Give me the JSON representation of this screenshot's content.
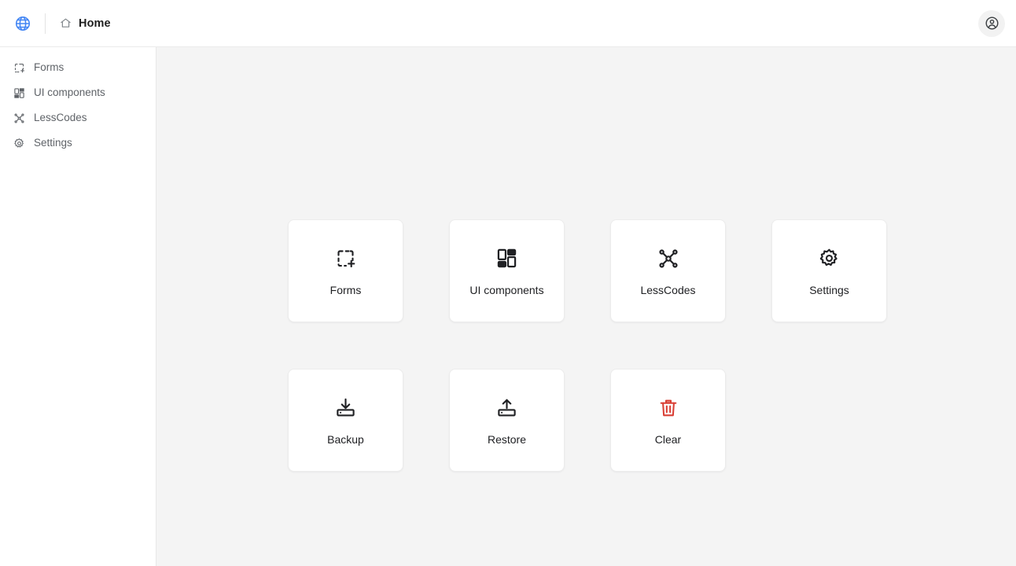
{
  "topbar": {
    "brand_icon": "globe-icon",
    "brand_color": "#4285f4",
    "breadcrumb_icon": "home-icon",
    "breadcrumb_label": "Home",
    "avatar_icon": "user-circle-icon"
  },
  "sidebar": {
    "items": [
      {
        "label": "Forms",
        "icon": "dashed-square-plus-icon"
      },
      {
        "label": "UI components",
        "icon": "layout-blocks-icon"
      },
      {
        "label": "LessCodes",
        "icon": "node-network-icon"
      },
      {
        "label": "Settings",
        "icon": "gear-icon"
      }
    ]
  },
  "main": {
    "tiles": [
      {
        "label": "Forms",
        "icon": "dashed-square-plus-icon",
        "color": "#202124"
      },
      {
        "label": "UI components",
        "icon": "layout-blocks-icon",
        "color": "#202124"
      },
      {
        "label": "LessCodes",
        "icon": "node-network-icon",
        "color": "#202124"
      },
      {
        "label": "Settings",
        "icon": "gear-icon",
        "color": "#202124"
      },
      {
        "label": "Backup",
        "icon": "download-tray-icon",
        "color": "#202124"
      },
      {
        "label": "Restore",
        "icon": "upload-tray-icon",
        "color": "#202124"
      },
      {
        "label": "Clear",
        "icon": "trash-icon",
        "color": "#d93f35"
      }
    ]
  },
  "colors": {
    "accent_blue": "#4285f4",
    "danger_red": "#d93f35",
    "canvas_bg": "#f4f4f4",
    "panel_bg": "#ffffff"
  }
}
